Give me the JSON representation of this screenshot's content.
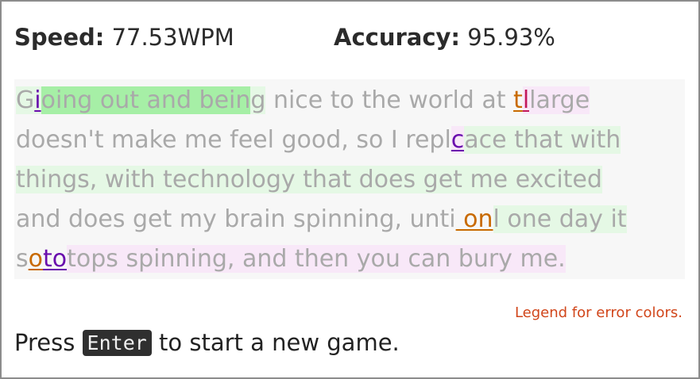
{
  "stats": {
    "speed_label": "Speed:",
    "speed_value": "77.53WPM",
    "accuracy_label": "Accuracy:",
    "accuracy_value": "95.93%"
  },
  "text_lines": [
    [
      "G",
      "i",
      "oing out and bein",
      "g",
      " nice to the world at ",
      "t",
      "l",
      "large"
    ],
    [
      "doesn't make me feel good, so I repl",
      "c",
      "ace that with"
    ],
    [
      "things, with technology that does get me excited"
    ],
    [
      "and does get my brain spinning, unti",
      " on",
      "l one day it"
    ],
    [
      "s",
      "o",
      "to",
      "tops spinning, and then you can bury me."
    ]
  ],
  "legend_link": "Legend for error colors.",
  "prompt": {
    "before": "Press",
    "key": "Enter",
    "after": "to start a new game."
  },
  "colors": {
    "typed_text": "#a9a9a9",
    "fast_highlight": "#a6efa6",
    "slow_highlight": "#f3ddf3",
    "error_purple": "#6a0dad",
    "error_orange": "#c86a00",
    "error_pink": "#c2185b",
    "legend_link": "#d1461b",
    "key_background": "#2f2f2f"
  }
}
